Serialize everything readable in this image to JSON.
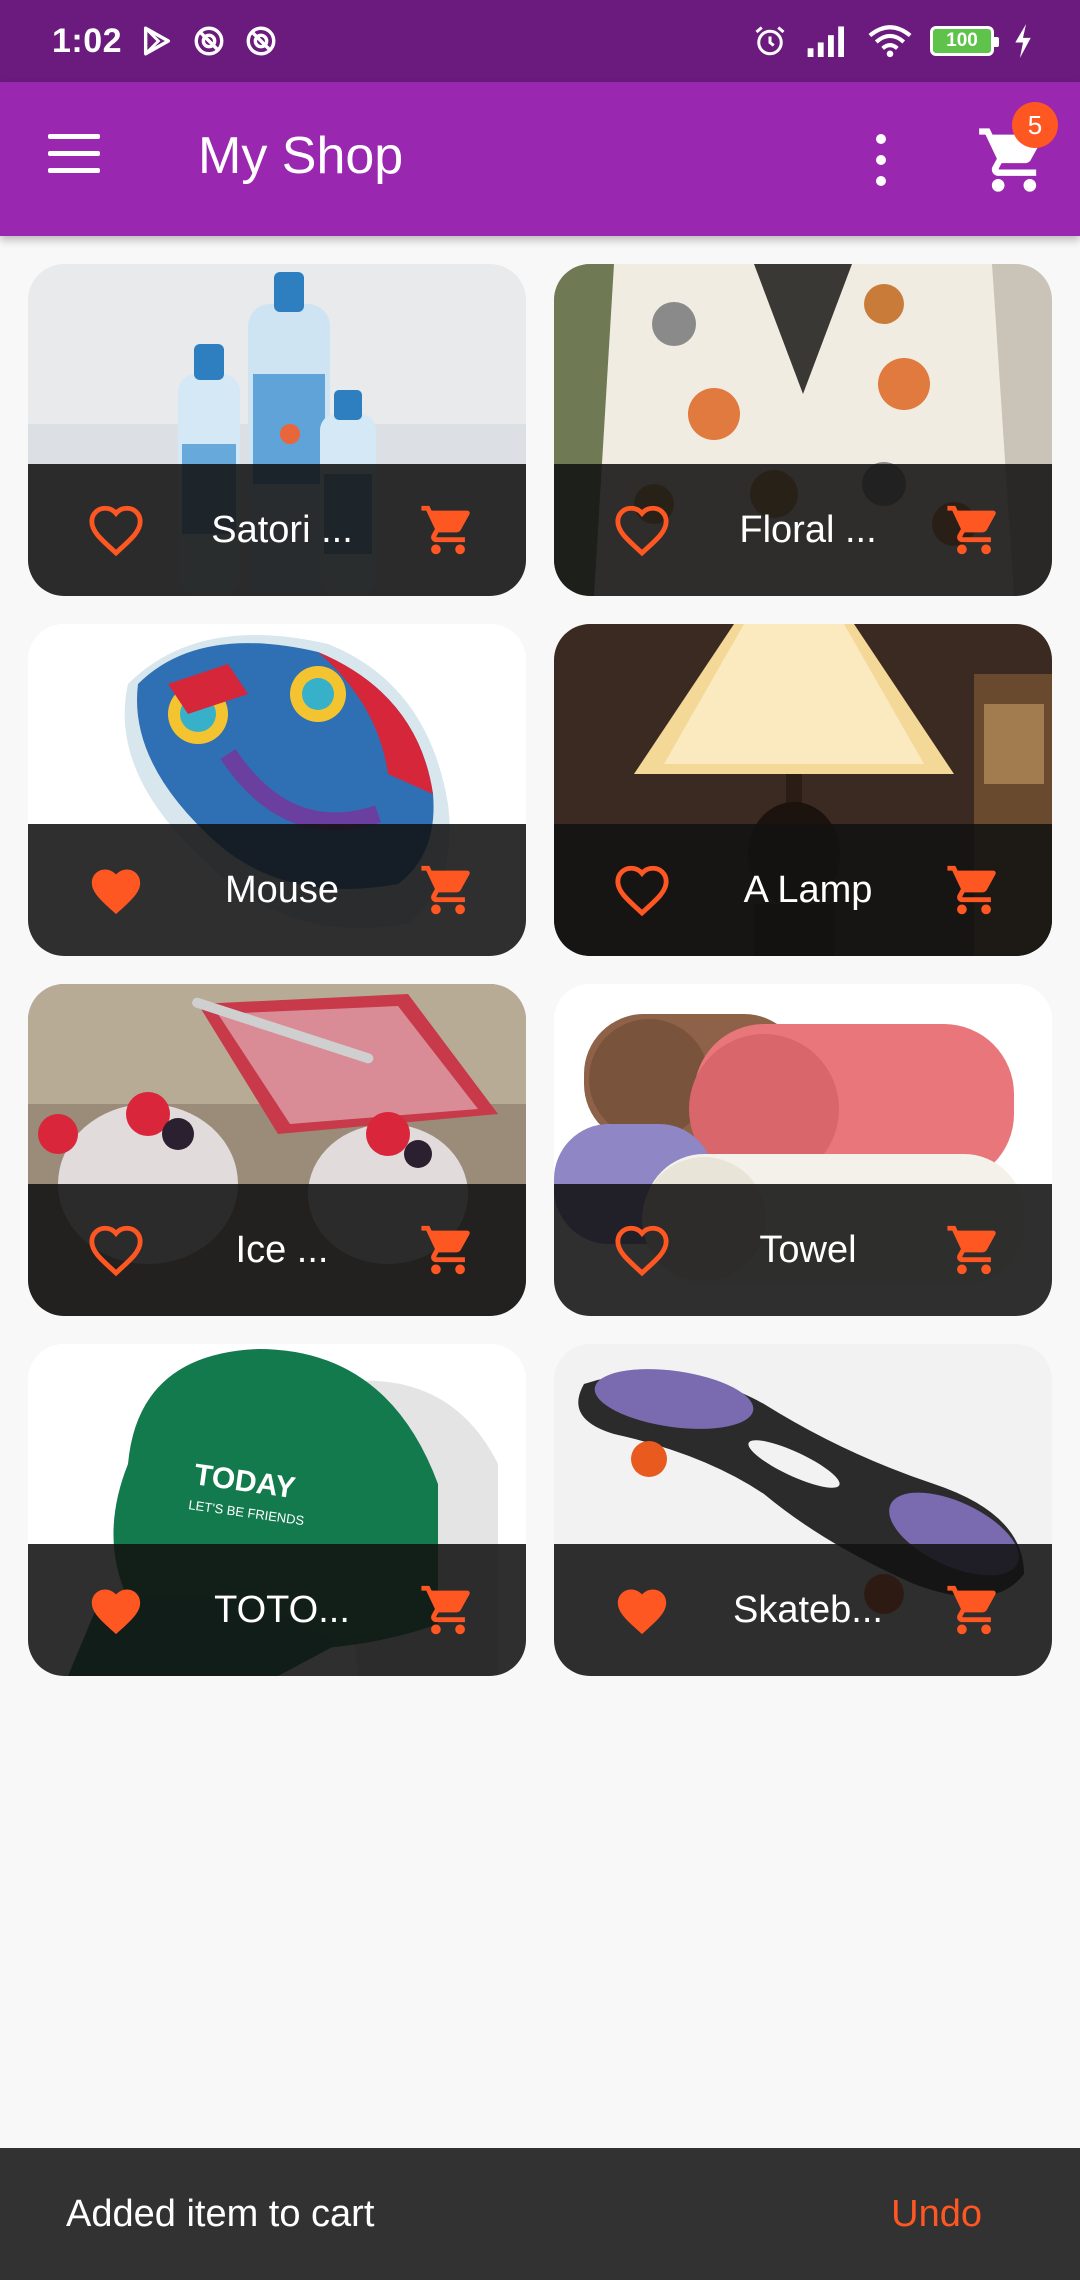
{
  "status_bar": {
    "time": "1:02",
    "battery": "100",
    "icons": [
      "play-store-icon",
      "vpn-icon",
      "vpn-icon",
      "alarm-icon",
      "signal-icon",
      "wifi-icon",
      "battery-icon",
      "charging-icon"
    ]
  },
  "app_bar": {
    "title": "My Shop",
    "cart_count": "5",
    "icons": [
      "menu-icon",
      "more-vert-icon",
      "shopping-cart-icon"
    ]
  },
  "colors": {
    "status_bar": "#6a1b7d",
    "app_bar": "#9a27b0",
    "accent": "#ff5722",
    "card_footer": "#121212",
    "snackbar": "#323232"
  },
  "products": [
    {
      "title": "Satori ...",
      "favorite": false,
      "image": "water-bottles"
    },
    {
      "title": "Floral ...",
      "favorite": false,
      "image": "floral-cardigan"
    },
    {
      "title": "Mouse",
      "favorite": true,
      "image": "colorful-mouse"
    },
    {
      "title": "A Lamp",
      "favorite": false,
      "image": "table-lamp"
    },
    {
      "title": "Ice ...",
      "favorite": false,
      "image": "ice-cream-dessert"
    },
    {
      "title": "Towel",
      "favorite": false,
      "image": "rolled-towels"
    },
    {
      "title": "TOTO...",
      "favorite": true,
      "image": "green-cap"
    },
    {
      "title": "Skateb...",
      "favorite": true,
      "image": "waveboard"
    }
  ],
  "snackbar": {
    "message": "Added item to cart",
    "action": "Undo"
  }
}
